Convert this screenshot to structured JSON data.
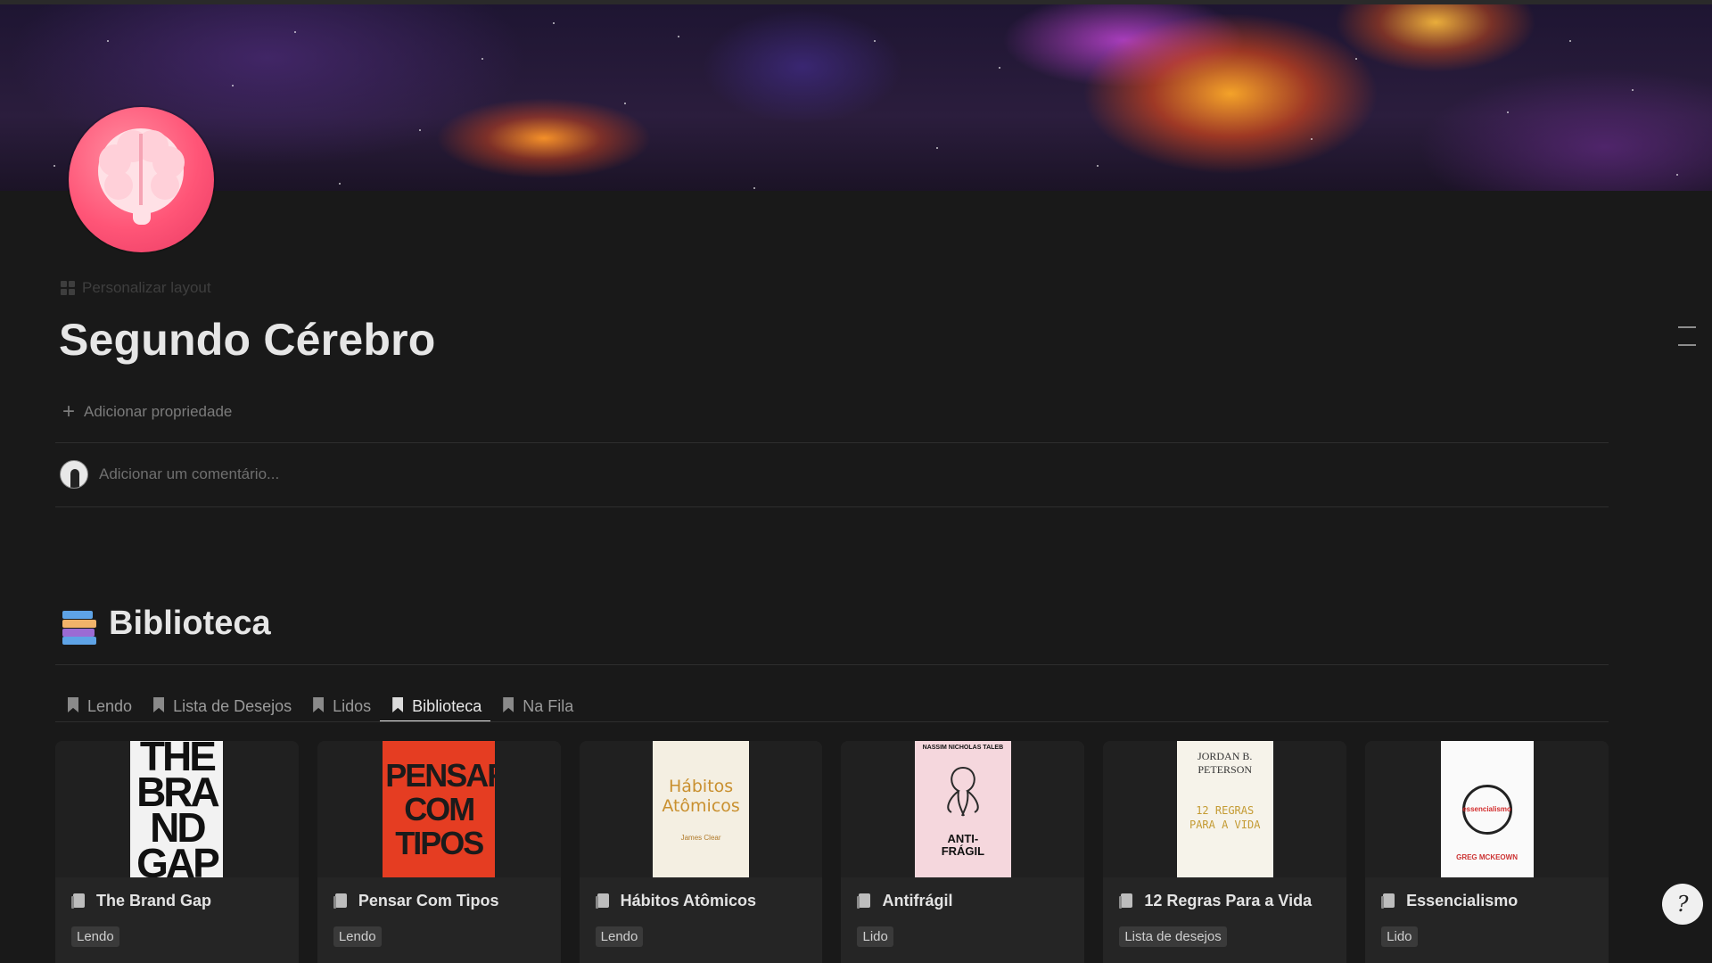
{
  "page": {
    "custom_layout_label": "Personalizar layout",
    "title": "Segundo Cérebro",
    "add_property_label": "Adicionar propriedade",
    "comment_placeholder": "Adicionar um comentário..."
  },
  "library": {
    "title": "Biblioteca",
    "tabs": [
      {
        "label": "Lendo"
      },
      {
        "label": "Lista de Desejos"
      },
      {
        "label": "Lidos"
      },
      {
        "label": "Biblioteca",
        "active": true
      },
      {
        "label": "Na Fila"
      }
    ],
    "cards": [
      {
        "name": "The Brand Gap",
        "status": "Lendo",
        "cover_text": "THE BRAND GAP"
      },
      {
        "name": "Pensar Com Tipos",
        "status": "Lendo",
        "cover_text": "PENSAR COM TIPOS"
      },
      {
        "name": "Hábitos Atômicos",
        "status": "Lendo",
        "cover_text": "Hábitos Atômicos",
        "cover_author": "James Clear"
      },
      {
        "name": "Antifrágil",
        "status": "Lido",
        "cover_text": "ANTI-FRÁGIL",
        "cover_author": "NASSIM NICHOLAS TALEB"
      },
      {
        "name": "12 Regras Para a Vida",
        "status": "Lista de desejos",
        "cover_text": "12 REGRAS PARA A VIDA",
        "cover_author": "JORDAN B. PETERSON"
      },
      {
        "name": "Essencialismo",
        "status": "Lido",
        "cover_text": "essencialismo",
        "cover_author": "GREG MCKEOWN"
      }
    ]
  },
  "icons": {
    "page_icon": "brain-icon",
    "library_icon": "books-icon",
    "help": "help-icon"
  },
  "colors": {
    "background": "#191919",
    "page_icon": "#ff5577",
    "text": "#e6e6e6"
  }
}
